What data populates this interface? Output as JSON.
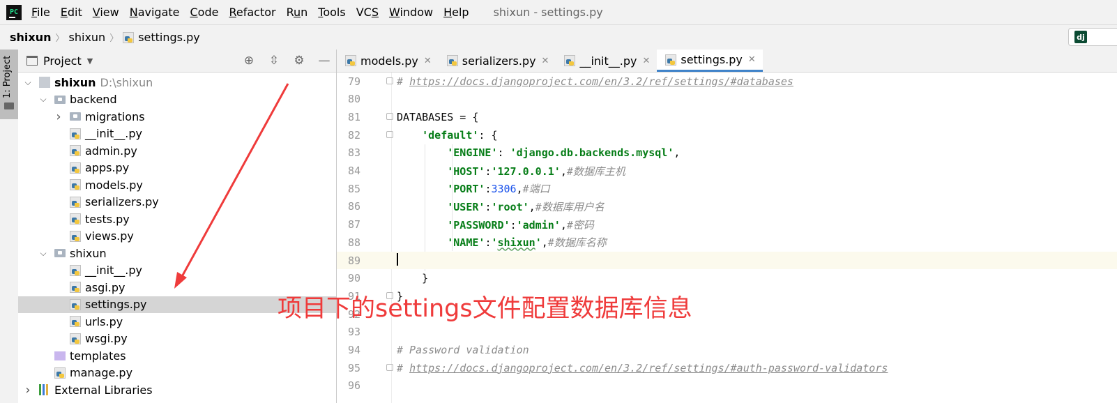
{
  "menubar": {
    "app_icon": "pycharm-logo",
    "items": [
      {
        "label": "File",
        "mnemonic": "F"
      },
      {
        "label": "Edit",
        "mnemonic": "E"
      },
      {
        "label": "View",
        "mnemonic": "V"
      },
      {
        "label": "Navigate",
        "mnemonic": "N"
      },
      {
        "label": "Code",
        "mnemonic": "C"
      },
      {
        "label": "Refactor",
        "mnemonic": "R"
      },
      {
        "label": "Run",
        "mnemonic": "u"
      },
      {
        "label": "Tools",
        "mnemonic": "T"
      },
      {
        "label": "VCS",
        "mnemonic": "S"
      },
      {
        "label": "Window",
        "mnemonic": "W"
      },
      {
        "label": "Help",
        "mnemonic": "H"
      }
    ],
    "window_title": "shixun - settings.py"
  },
  "breadcrumb": {
    "items": [
      "shixun",
      "shixun",
      "settings.py"
    ],
    "django_icon": "dj"
  },
  "toolstrip": {
    "project_tab_label": "1: Project"
  },
  "project_panel": {
    "title": "Project",
    "tools": [
      "locate-icon",
      "collapse-all-icon",
      "gear-icon",
      "hide-icon"
    ],
    "tree": [
      {
        "label": "shixun",
        "hint": "D:\\shixun",
        "icon": "module",
        "expanded": true,
        "bold": true
      },
      {
        "label": "backend",
        "icon": "folder",
        "expanded": true
      },
      {
        "label": "migrations",
        "icon": "folder",
        "expanded": false
      },
      {
        "label": "__init__.py",
        "icon": "py"
      },
      {
        "label": "admin.py",
        "icon": "py"
      },
      {
        "label": "apps.py",
        "icon": "py"
      },
      {
        "label": "models.py",
        "icon": "py"
      },
      {
        "label": "serializers.py",
        "icon": "py"
      },
      {
        "label": "tests.py",
        "icon": "py"
      },
      {
        "label": "views.py",
        "icon": "py"
      },
      {
        "label": "shixun",
        "icon": "folder",
        "expanded": true
      },
      {
        "label": "__init__.py",
        "icon": "py"
      },
      {
        "label": "asgi.py",
        "icon": "py"
      },
      {
        "label": "settings.py",
        "icon": "py",
        "selected": true
      },
      {
        "label": "urls.py",
        "icon": "py"
      },
      {
        "label": "wsgi.py",
        "icon": "py"
      },
      {
        "label": "templates",
        "icon": "tmpl"
      },
      {
        "label": "manage.py",
        "icon": "py"
      },
      {
        "label": "External Libraries",
        "icon": "lib",
        "expanded": false
      }
    ]
  },
  "editor": {
    "tabs": [
      {
        "label": "models.py",
        "active": false
      },
      {
        "label": "serializers.py",
        "active": false
      },
      {
        "label": "__init__.py",
        "active": false
      },
      {
        "label": "settings.py",
        "active": true
      }
    ],
    "current_line": 89,
    "lines": [
      {
        "n": "79",
        "segments": [
          [
            "cmt",
            "# "
          ],
          [
            "link",
            "https://docs.djangoproject.com/en/3.2/ref/settings/#databases"
          ]
        ]
      },
      {
        "n": "80",
        "segments": []
      },
      {
        "n": "81",
        "segments": [
          [
            "plain",
            "DATABASES = {"
          ]
        ]
      },
      {
        "n": "82",
        "segments": [
          [
            "plain",
            "    "
          ],
          [
            "str",
            "'default'"
          ],
          [
            "plain",
            ": {"
          ]
        ]
      },
      {
        "n": "83",
        "segments": [
          [
            "plain",
            "        "
          ],
          [
            "str",
            "'ENGINE'"
          ],
          [
            "plain",
            ": "
          ],
          [
            "str",
            "'django.db.backends.mysql'"
          ],
          [
            "plain",
            ","
          ]
        ]
      },
      {
        "n": "84",
        "segments": [
          [
            "plain",
            "        "
          ],
          [
            "str",
            "'HOST'"
          ],
          [
            "plain",
            ":"
          ],
          [
            "str",
            "'127.0.0.1'"
          ],
          [
            "plain",
            ","
          ],
          [
            "cmt",
            "#数据库主机"
          ]
        ]
      },
      {
        "n": "85",
        "segments": [
          [
            "plain",
            "        "
          ],
          [
            "str",
            "'PORT'"
          ],
          [
            "plain",
            ":"
          ],
          [
            "num",
            "3306"
          ],
          [
            "plain",
            ","
          ],
          [
            "cmt",
            "#端口"
          ]
        ]
      },
      {
        "n": "86",
        "segments": [
          [
            "plain",
            "        "
          ],
          [
            "str",
            "'USER'"
          ],
          [
            "plain",
            ":"
          ],
          [
            "str",
            "'root'"
          ],
          [
            "plain",
            ","
          ],
          [
            "cmt",
            "#数据库用户名"
          ]
        ]
      },
      {
        "n": "87",
        "segments": [
          [
            "plain",
            "        "
          ],
          [
            "str",
            "'PASSWORD'"
          ],
          [
            "plain",
            ":"
          ],
          [
            "str",
            "'admin'"
          ],
          [
            "plain",
            ","
          ],
          [
            "cmt",
            "#密码"
          ]
        ]
      },
      {
        "n": "88",
        "segments": [
          [
            "plain",
            "        "
          ],
          [
            "str",
            "'NAME'"
          ],
          [
            "plain",
            ":"
          ],
          [
            "str",
            "'"
          ],
          [
            "strsq",
            "shixun"
          ],
          [
            "str",
            "'"
          ],
          [
            "plain",
            ","
          ],
          [
            "cmt",
            "#数据库名称"
          ]
        ]
      },
      {
        "n": "89",
        "segments": [
          [
            "caret",
            ""
          ]
        ]
      },
      {
        "n": "90",
        "segments": [
          [
            "plain",
            "    }"
          ]
        ]
      },
      {
        "n": "91",
        "segments": [
          [
            "plain",
            "}"
          ]
        ]
      },
      {
        "n": "92",
        "segments": []
      },
      {
        "n": "93",
        "segments": []
      },
      {
        "n": "94",
        "segments": [
          [
            "cmt",
            "# Password validation"
          ]
        ]
      },
      {
        "n": "95",
        "segments": [
          [
            "cmt",
            "# "
          ],
          [
            "link",
            "https://docs.djangoproject.com/en/3.2/ref/settings/#auth-password-validators"
          ]
        ]
      },
      {
        "n": "96",
        "segments": []
      }
    ]
  },
  "annotation": {
    "text": "项目下的settings文件配置数据库信息",
    "color": "#ef3b3b"
  },
  "colors": {
    "accent": "#4083c9",
    "selection": "#d5d5d5",
    "string": "#067d17",
    "number": "#1750eb",
    "comment": "#8c8c8c"
  }
}
